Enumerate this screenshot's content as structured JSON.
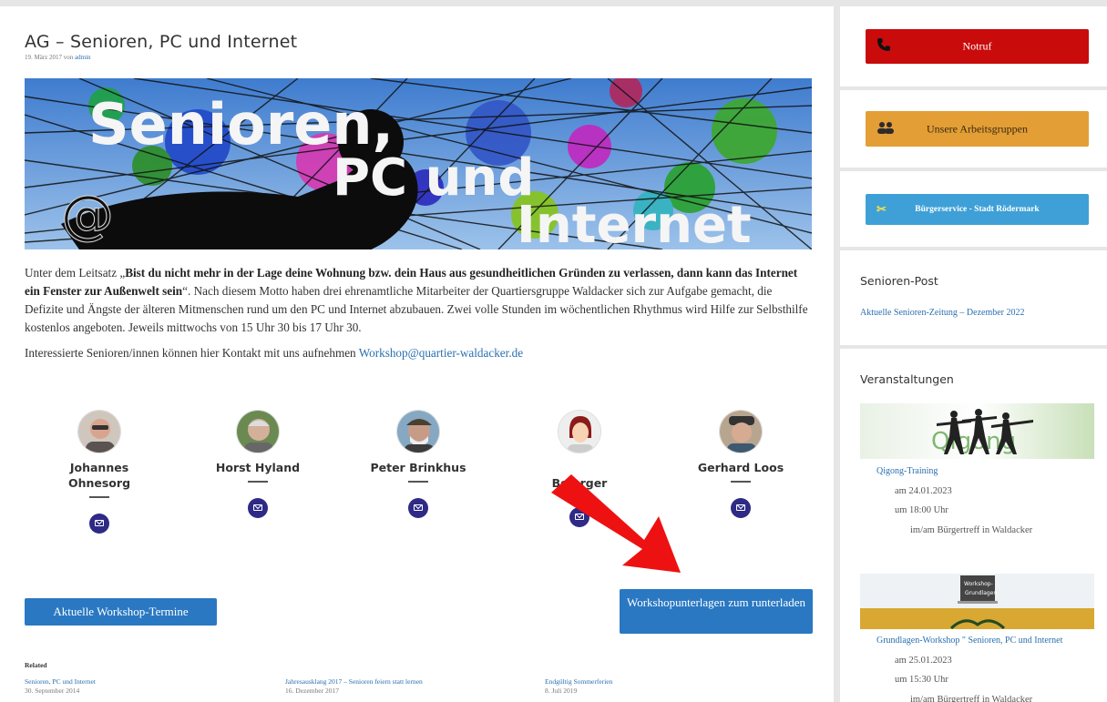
{
  "post": {
    "title": "AG – Senioren, PC und Internet",
    "meta_date": "19. März 2017 von",
    "meta_author": "admin"
  },
  "banner": {
    "line1": "Senioren,",
    "line2": "PC und",
    "line3": "Internet"
  },
  "intro": {
    "lead": "Unter dem Leitsatz „",
    "motto": "Bist du nicht mehr in der Lage deine Wohnung bzw. dein Haus aus gesundheitlichen Gründen zu verlassen, dann kann das Internet ein Fenster zur Außenwelt sein",
    "rest": "“. Nach diesem Motto haben drei ehrenamtliche Mitarbeiter der Quartiersgruppe Waldacker sich zur Aufgabe gemacht, die Defizite und Ängste der älteren Mitmenschen rund um den PC und Internet abzubauen. Zwei volle Stunden im wöchentlichen Rhythmus wird Hilfe zur Selbsthilfe kostenlos angeboten. Jeweils mittwochs von 15 Uhr 30 bis 17 Uhr 30."
  },
  "contact": {
    "text": "Interessierte Senioren/innen können hier Kontakt mit uns aufnehmen",
    "email": "Workshop@quartier-waldacker.de"
  },
  "team": [
    {
      "name": "Johannes Ohnesorg"
    },
    {
      "name": "Horst Hyland"
    },
    {
      "name": "Peter Brinkhus"
    },
    {
      "name": "Bo    erger"
    },
    {
      "name": "Gerhard Loos"
    }
  ],
  "buttons": {
    "termine": "Aktuelle Workshop-Termine",
    "unterlagen": "Workshopunterlagen zum runterladen"
  },
  "related": {
    "title": "Related",
    "items": [
      {
        "title": "Senioren, PC und Internet",
        "date": "30. September 2014"
      },
      {
        "title": "Jahresausklang 2017 – Senioren feiern statt lernen",
        "date": "16. Dezember 2017"
      },
      {
        "title": "Endgültig Sommerferien",
        "date": "8. Juli 2019"
      }
    ]
  },
  "sidebar": {
    "notruf": "Notruf",
    "arbeitsgruppen": "Unsere Arbeitsgruppen",
    "buergerservice": "Bürgerservice - Stadt Rödermark",
    "senioren_post_title": "Senioren-Post",
    "senioren_post_link": "Aktuelle Senioren-Zeitung – Dezember 2022",
    "veranstaltungen_title": "Veranstaltungen",
    "events": [
      {
        "image_text": "Qigong",
        "title": "Qigong-Training",
        "date": "am 24.01.2023",
        "time": "um 18:00 Uhr",
        "location": "im/am Bürgertreff in Waldacker"
      },
      {
        "image_text": "Workshop-Grundlagen",
        "title": "Grundlagen-Workshop \" Senioren, PC und Internet",
        "date": "am 25.01.2023",
        "time": "um 15:30 Uhr",
        "location": "im/am Bürgertreff in Waldacker"
      }
    ]
  },
  "colors": {
    "link": "#2a6fb0",
    "button_blue": "#2a78c2",
    "notruf_red": "#c90b0b",
    "ag_orange": "#e39e36",
    "buerger_blue": "#3ea0d6",
    "mail_navy": "#2e2a85",
    "arrow_red": "#ee1111"
  }
}
